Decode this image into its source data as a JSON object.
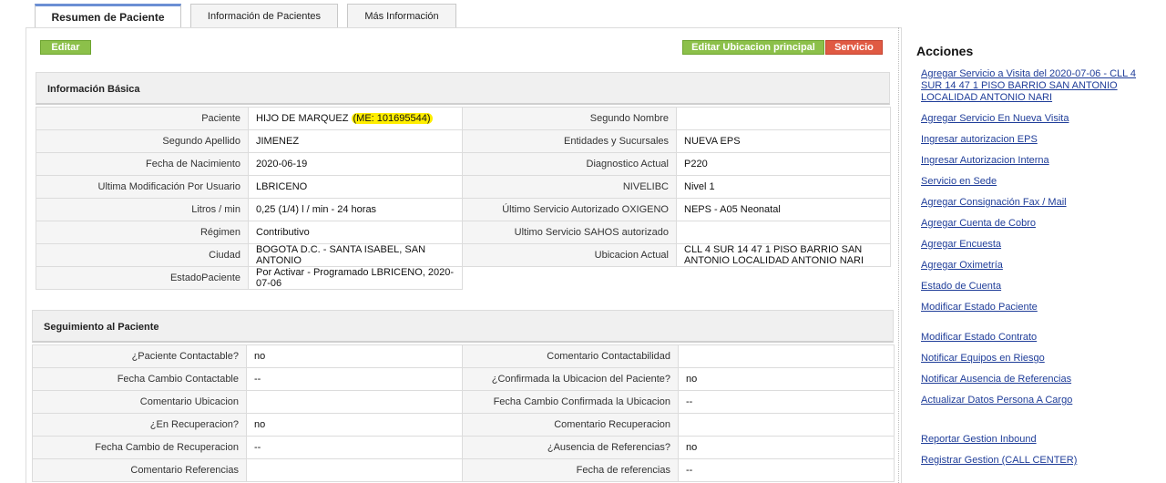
{
  "tabs": [
    {
      "label": "Resumen de Paciente"
    },
    {
      "label": "Información de Pacientes"
    },
    {
      "label": "Más Información"
    }
  ],
  "toolbar": {
    "edit_label": "Editar",
    "edit_location_label": "Editar Ubicacion principal",
    "service_label": "Servicio"
  },
  "basic_info": {
    "title": "Información Básica",
    "rows": [
      {
        "l1": "Paciente",
        "v1": "HIJO DE MARQUEZ ",
        "v1_hl": "(ME: 101695544)",
        "l2": "Segundo Nombre",
        "v2": ""
      },
      {
        "l1": "Segundo Apellido",
        "v1": " JIMENEZ",
        "l2": "Entidades y Sucursales",
        "v2": "NUEVA EPS"
      },
      {
        "l1": "Fecha de Nacimiento",
        "v1": "2020-06-19",
        "l2": "Diagnostico Actual",
        "v2": "P220"
      },
      {
        "l1": "Ultima Modificación Por Usuario",
        "v1": " LBRICENO",
        "l2": "NIVELIBC",
        "v2": " Nivel 1"
      },
      {
        "l1": "Litros / min",
        "v1": " 0,25 (1/4) l / min - 24 horas",
        "l2": "Último Servicio Autorizado OXIGENO",
        "v2": "NEPS - A05 Neonatal"
      },
      {
        "l1": "Régimen",
        "v1": " Contributivo",
        "l2": "Ultimo Servicio SAHOS autorizado",
        "v2": ""
      },
      {
        "l1": "Ciudad",
        "v1": " BOGOTA D.C. - SANTA ISABEL, SAN ANTONIO",
        "l2": "Ubicacion Actual",
        "v2": "CLL 4 SUR 14 47 1 PISO BARRIO SAN ANTONIO LOCALIDAD ANTONIO NARI"
      },
      {
        "l1": "EstadoPaciente",
        "v1": " Por Activar - Programado LBRICENO, 2020-07-06"
      }
    ]
  },
  "followup": {
    "title": "Seguimiento al Paciente",
    "rows": [
      {
        "l1": "¿Paciente Contactable?",
        "v1": "no",
        "l2": "Comentario Contactabilidad",
        "v2": ""
      },
      {
        "l1": "Fecha Cambio Contactable",
        "v1": "--",
        "l2": "¿Confirmada la Ubicacion del Paciente?",
        "v2": "no"
      },
      {
        "l1": "Comentario Ubicacion",
        "v1": "",
        "l2": "Fecha Cambio Confirmada la Ubicacion",
        "v2": "--"
      },
      {
        "l1": "¿En Recuperacion?",
        "v1": "no",
        "l2": "Comentario Recuperacion",
        "v2": ""
      },
      {
        "l1": "Fecha Cambio de Recuperacion",
        "v1": "--",
        "l2": "¿Ausencia de Referencias?",
        "v2": "no"
      },
      {
        "l1": "Comentario Referencias",
        "v1": "",
        "l2": "Fecha de referencias",
        "v2": "--"
      }
    ]
  },
  "sidebar": {
    "title": "Acciones",
    "links": [
      "Agregar Servicio a Visita del 2020-07-06 - CLL 4 SUR 14 47 1 PISO BARRIO SAN ANTONIO LOCALIDAD ANTONIO NARI",
      "Agregar Servicio En Nueva Visita",
      "Ingresar autorizacion EPS",
      "Ingresar Autorizacion Interna",
      "Servicio en Sede",
      "Agregar Consignación Fax / Mail",
      "Agregar Cuenta de Cobro",
      "Agregar Encuesta",
      "Agregar Oximetría",
      "Estado de Cuenta",
      "Modificar Estado Paciente",
      "Modificar Estado Contrato",
      "Notificar Equipos en Riesgo",
      "Notificar Ausencia de Referencias",
      "Actualizar Datos Persona A Cargo",
      "Reportar Gestion Inbound",
      "Registrar Gestion (CALL CENTER)"
    ]
  }
}
